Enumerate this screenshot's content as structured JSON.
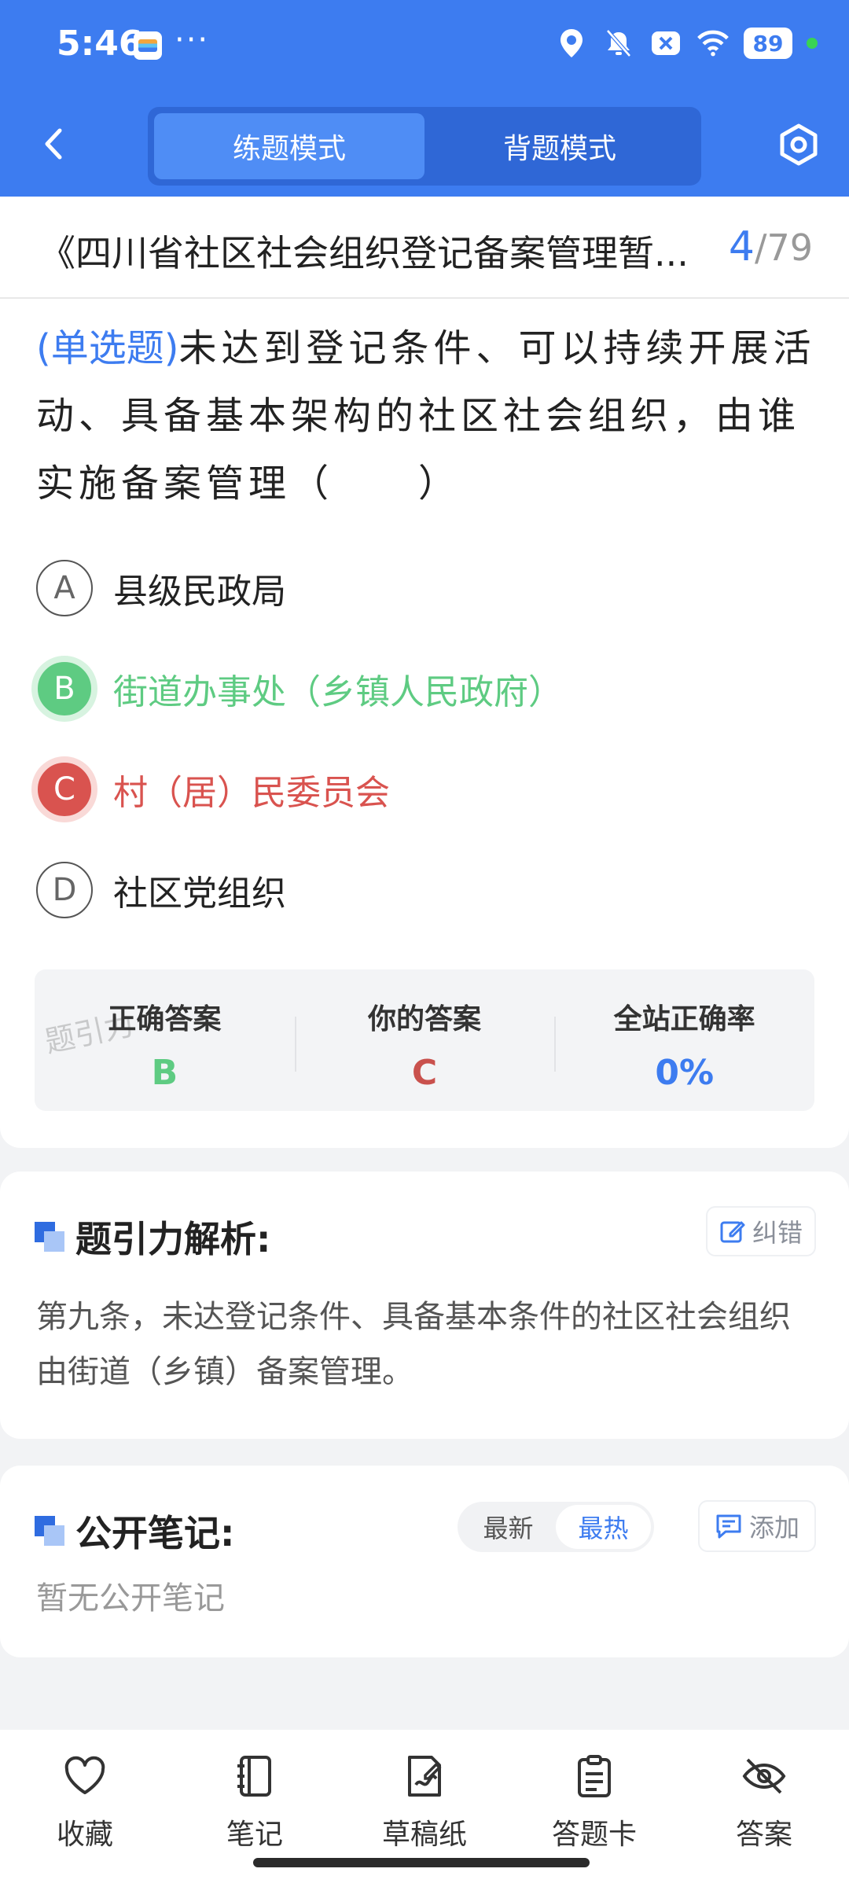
{
  "status_bar": {
    "time": "5:46",
    "dots": "···",
    "battery": "89",
    "icons": [
      "location-icon",
      "bell-off-icon",
      "close-badge-icon",
      "wifi-icon",
      "battery-icon"
    ]
  },
  "nav": {
    "modes": [
      "练题模式",
      "背题模式"
    ],
    "active_mode": "练题模式"
  },
  "header": {
    "title": "《四川省社区社会组织登记备案管理暂...",
    "current": "4",
    "total": "/79"
  },
  "question": {
    "type_label": "(单选题)",
    "text": "未达到登记条件、可以持续开展活动、具备基本架构的社区社会组织，由谁实施备案管理（　　）",
    "options": [
      {
        "letter": "A",
        "text": "县级民政局",
        "state": "normal"
      },
      {
        "letter": "B",
        "text": "街道办事处（乡镇人民政府）",
        "state": "correct"
      },
      {
        "letter": "C",
        "text": "村（居）民委员会",
        "state": "wrong"
      },
      {
        "letter": "D",
        "text": "社区党组织",
        "state": "normal"
      }
    ]
  },
  "result": {
    "correct_label": "正确答案",
    "correct_value": "B",
    "yours_label": "你的答案",
    "yours_value": "C",
    "rate_label": "全站正确率",
    "rate_value": "0%",
    "watermark": "题引力"
  },
  "analysis": {
    "title": "题引力解析:",
    "fix_label": "纠错",
    "text": "第九条，未达登记条件、具备基本条件的社区社会组织由街道（乡镇）备案管理。"
  },
  "notes": {
    "title": "公开笔记:",
    "sort_options": [
      "最新",
      "最热"
    ],
    "active_sort": "最热",
    "add_label": "添加",
    "empty_text": "暂无公开笔记"
  },
  "bottom_nav": [
    {
      "label": "收藏",
      "icon": "heart-icon"
    },
    {
      "label": "笔记",
      "icon": "notebook-icon"
    },
    {
      "label": "草稿纸",
      "icon": "draft-paper-icon"
    },
    {
      "label": "答题卡",
      "icon": "answer-card-icon"
    },
    {
      "label": "答案",
      "icon": "eye-off-icon"
    }
  ],
  "colors": {
    "primary": "#3d7cf0",
    "correct": "#5ecb82",
    "wrong": "#d9534f"
  }
}
